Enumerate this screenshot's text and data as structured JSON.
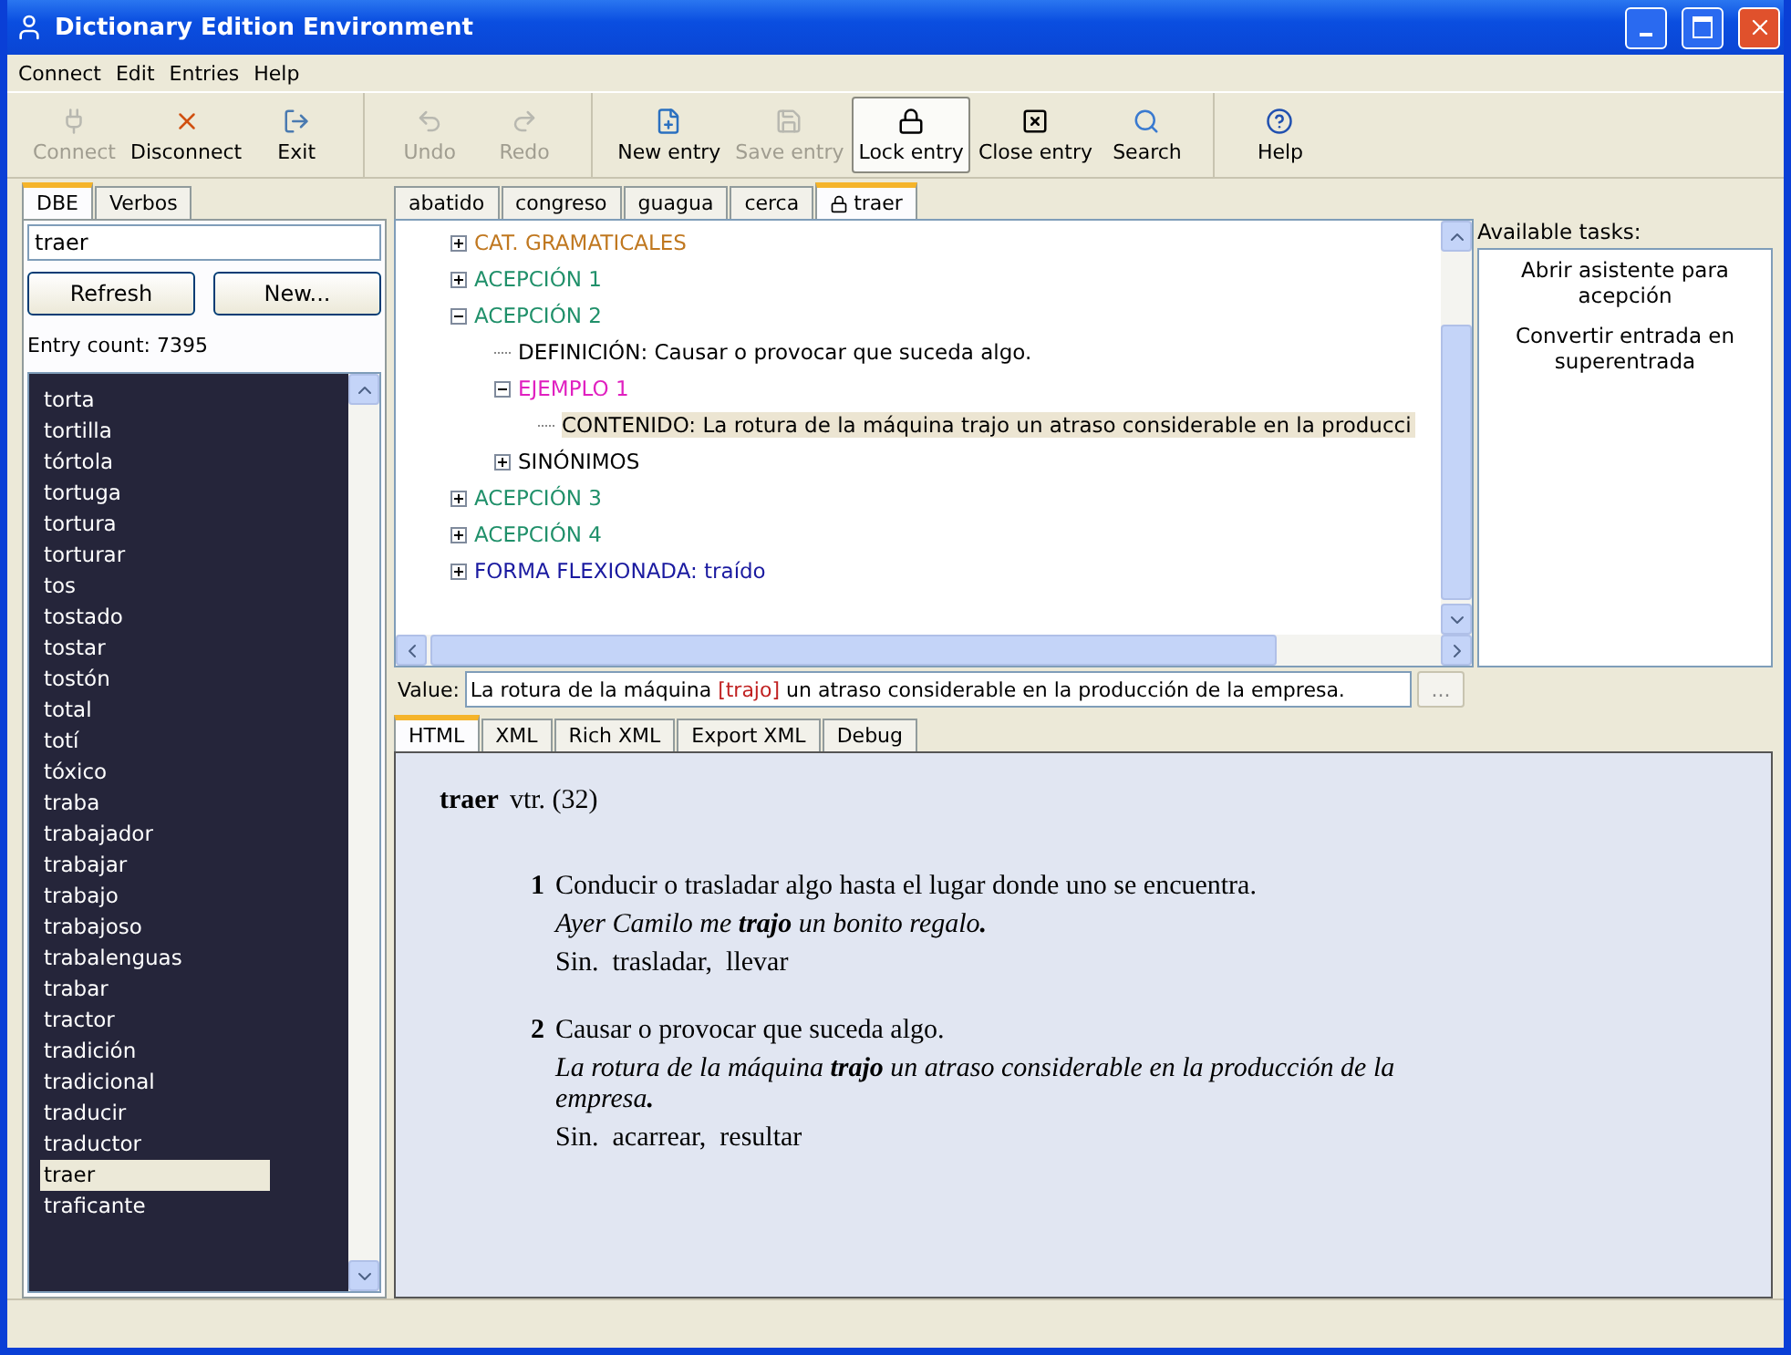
{
  "window": {
    "title": "Dictionary Edition Environment"
  },
  "menu": [
    "Connect",
    "Edit",
    "Entries",
    "Help"
  ],
  "toolbar": [
    [
      {
        "label": "Connect",
        "disabled": true,
        "pressed": false
      },
      {
        "label": "Disconnect",
        "disabled": false,
        "pressed": false
      },
      {
        "label": "Exit",
        "disabled": false,
        "pressed": false
      }
    ],
    [
      {
        "label": "Undo",
        "disabled": true,
        "pressed": false
      },
      {
        "label": "Redo",
        "disabled": true,
        "pressed": false
      }
    ],
    [
      {
        "label": "New entry",
        "disabled": false,
        "pressed": false
      },
      {
        "label": "Save entry",
        "disabled": true,
        "pressed": false
      },
      {
        "label": "Lock entry",
        "disabled": false,
        "pressed": true
      },
      {
        "label": "Close entry",
        "disabled": false,
        "pressed": false
      },
      {
        "label": "Search",
        "disabled": false,
        "pressed": false
      }
    ],
    [
      {
        "label": "Help",
        "disabled": false,
        "pressed": false
      }
    ]
  ],
  "left": {
    "tabs": [
      {
        "label": "DBE",
        "selected": true
      },
      {
        "label": "Verbos",
        "selected": false
      }
    ],
    "search": {
      "value": "traer"
    },
    "buttons": [
      "Refresh",
      "New..."
    ],
    "count": "Entry count: 7395",
    "entries": [
      {
        "text": "torta",
        "selected": false
      },
      {
        "text": "tortilla",
        "selected": false
      },
      {
        "text": "tórtola",
        "selected": false
      },
      {
        "text": "tortuga",
        "selected": false
      },
      {
        "text": "tortura",
        "selected": false
      },
      {
        "text": "torturar",
        "selected": false
      },
      {
        "text": "tos",
        "selected": false
      },
      {
        "text": "tostado",
        "selected": false
      },
      {
        "text": "tostar",
        "selected": false
      },
      {
        "text": "tostón",
        "selected": false
      },
      {
        "text": "total",
        "selected": false
      },
      {
        "text": "totí",
        "selected": false
      },
      {
        "text": "tóxico",
        "selected": false
      },
      {
        "text": "traba",
        "selected": false
      },
      {
        "text": "trabajador",
        "selected": false
      },
      {
        "text": "trabajar",
        "selected": false
      },
      {
        "text": "trabajo",
        "selected": false
      },
      {
        "text": "trabajoso",
        "selected": false
      },
      {
        "text": "trabalenguas",
        "selected": false
      },
      {
        "text": "trabar",
        "selected": false
      },
      {
        "text": "tractor",
        "selected": false
      },
      {
        "text": "tradición",
        "selected": false
      },
      {
        "text": "tradicional",
        "selected": false
      },
      {
        "text": "traducir",
        "selected": false
      },
      {
        "text": "traductor",
        "selected": false
      },
      {
        "text": "traer",
        "selected": true
      },
      {
        "text": "traficante",
        "selected": false
      }
    ]
  },
  "doc_tabs": [
    {
      "label": "abatido",
      "selected": false,
      "locked": false
    },
    {
      "label": "congreso",
      "selected": false,
      "locked": false
    },
    {
      "label": "guagua",
      "selected": false,
      "locked": false
    },
    {
      "label": "cerca",
      "selected": false,
      "locked": false
    },
    {
      "label": "traer",
      "selected": true,
      "locked": true
    }
  ],
  "tree": [
    {
      "label": "CAT. GRAMATICALES",
      "color": "#c07820",
      "expanded": false,
      "selected": false
    },
    {
      "label": "ACEPCIÓN 1",
      "color": "#20906a",
      "expanded": false,
      "selected": false
    },
    {
      "label": "ACEPCIÓN 2",
      "color": "#20906a",
      "expanded": true,
      "selected": false,
      "children": [
        {
          "label": "DEFINICIÓN: Causar o provocar que suceda algo.",
          "color": "#000000",
          "selected": false
        },
        {
          "label": "EJEMPLO 1",
          "color": "#e020c0",
          "expanded": true,
          "selected": false,
          "children": [
            {
              "label": "CONTENIDO: La rotura de la máquina trajo un atraso considerable en la producci",
              "color": "#000000",
              "selected": true
            }
          ]
        },
        {
          "label": "SINÓNIMOS",
          "color": "#000000",
          "expanded": false,
          "selected": false
        }
      ]
    },
    {
      "label": "ACEPCIÓN 3",
      "color": "#20906a",
      "expanded": false,
      "selected": false
    },
    {
      "label": "ACEPCIÓN 4",
      "color": "#20906a",
      "expanded": false,
      "selected": false
    },
    {
      "label": "FORMA FLEXIONADA: traído",
      "color": "#1a1aa0",
      "expanded": false,
      "selected": false
    }
  ],
  "tasks": {
    "title": "Available tasks:",
    "items": [
      "Abrir asistente para acepción",
      "Convertir entrada en superentrada"
    ]
  },
  "value": {
    "label": "Value:",
    "before": "La rotura de la máquina ",
    "highlight": "[trajo]",
    "after": " un atraso considerable en la producción de la empresa.",
    "button": "..."
  },
  "view_tabs": [
    {
      "label": "HTML",
      "selected": true
    },
    {
      "label": "XML",
      "selected": false
    },
    {
      "label": "Rich XML",
      "selected": false
    },
    {
      "label": "Export XML",
      "selected": false
    },
    {
      "label": "Debug",
      "selected": false
    }
  ],
  "article": {
    "headword": "traer",
    "grammar": "vtr. (32)",
    "senses": [
      {
        "number": "1",
        "definition": "Conducir o trasladar algo hasta el lugar donde uno se encuentra.",
        "example": "Ayer Camilo me **trajo** un bonito regalo**.**",
        "synonyms": "Sin.  trasladar,  llevar"
      },
      {
        "number": "2",
        "definition": "Causar o provocar que suceda algo.",
        "example": "La rotura de la máquina **trajo** un atraso considerable en la producción de la empresa**.**",
        "synonyms": "Sin.  acarrear,  resultar"
      }
    ]
  }
}
